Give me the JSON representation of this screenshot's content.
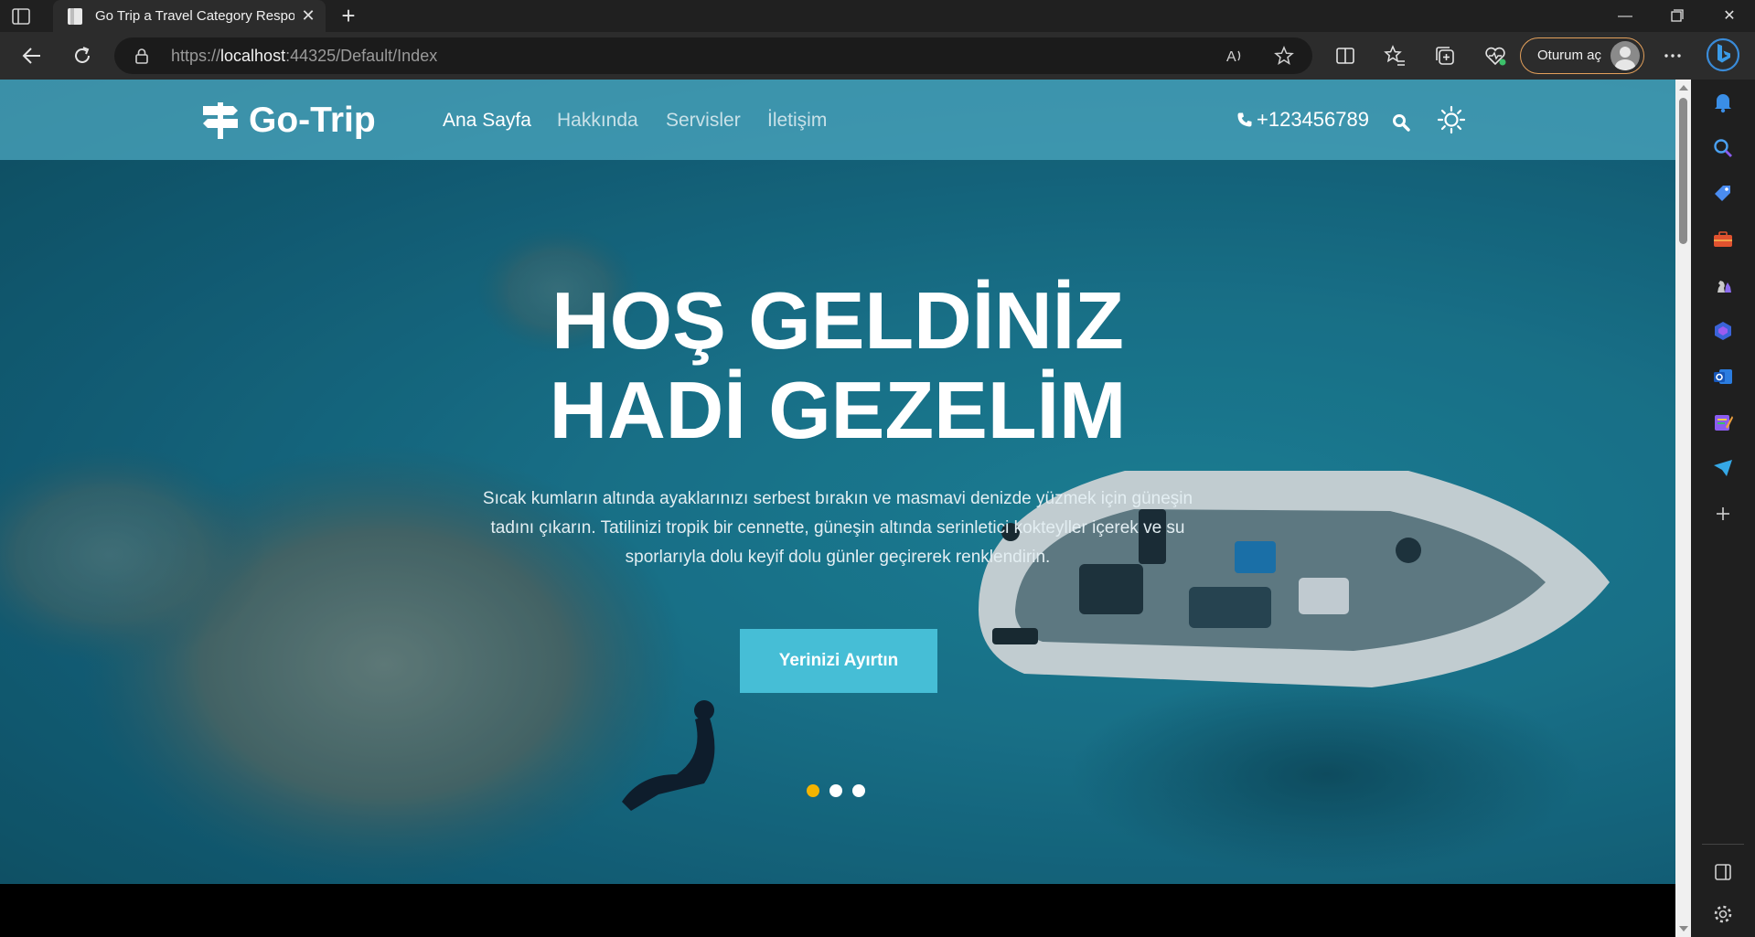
{
  "browser": {
    "tab_title": "Go Trip a Travel Category Responsive",
    "url_prefix": "https://",
    "url_host": "localhost",
    "url_rest": ":44325/Default/Index",
    "signin_label": "Oturum aç",
    "accent_color": "#e3a05b"
  },
  "site": {
    "brand": "Go-Trip",
    "nav": {
      "home": "Ana Sayfa",
      "about": "Hakkında",
      "services": "Servisler",
      "contact": "İletişim"
    },
    "phone": "+123456789",
    "hero": {
      "title_line1": "HOŞ GELDİNİZ",
      "title_line2": "HADİ GEZELİM",
      "text": "Sıcak kumların altında ayaklarınızı serbest bırakın ve masmavi denizde yüzmek için güneşin tadını çıkarın. Tatilinizi tropik bir cennette, güneşin altında serinletici kokteyller içerek ve su sporlarıyla dolu keyif dolu günler geçirerek renklendirin.",
      "button": "Yerinizi Ayırtın",
      "button_color": "#46bed6",
      "slides": {
        "count": 3,
        "active": 1,
        "active_color": "#f4b400"
      }
    }
  },
  "icons": {
    "tab_actions": "tab-actions-icon",
    "back": "back-arrow-icon",
    "refresh": "refresh-icon",
    "lock": "lock-icon",
    "read_aloud": "read-aloud-icon",
    "favorite": "star-icon",
    "split": "split-screen-icon",
    "favorites": "favorites-icon",
    "collections": "collections-icon",
    "health": "browser-essentials-icon",
    "more": "more-icon",
    "bing": "bing-copilot-icon"
  }
}
